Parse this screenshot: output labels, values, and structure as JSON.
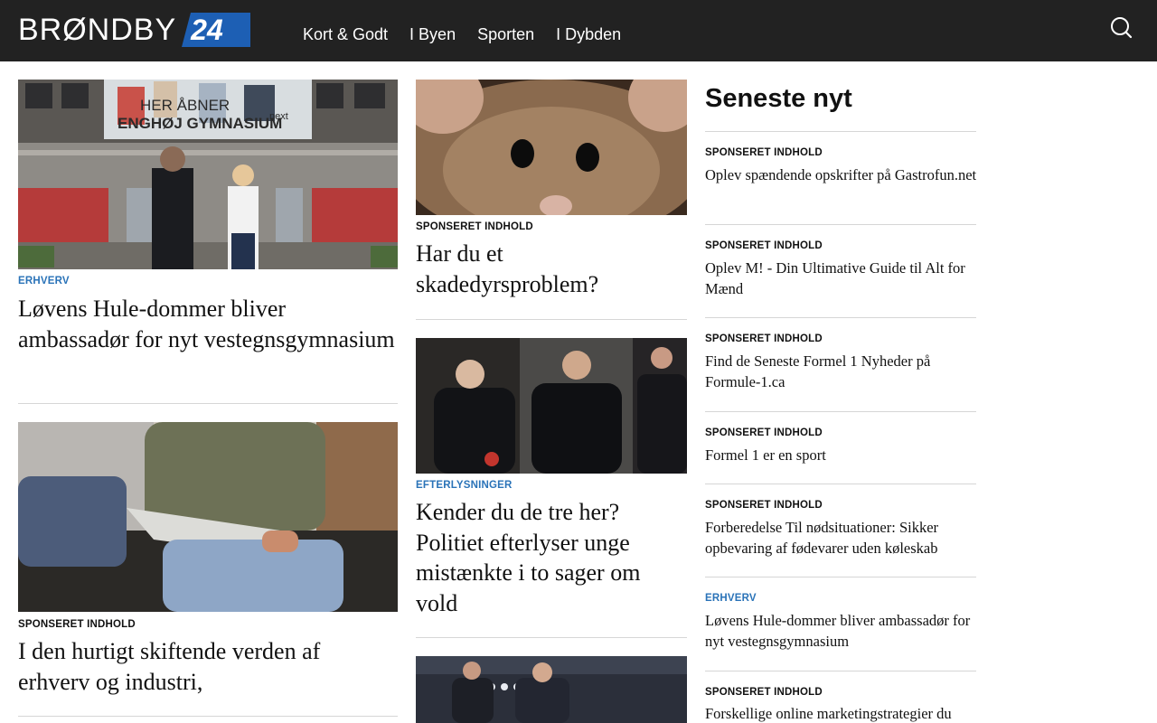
{
  "header": {
    "logo_text": "BRØNDBY",
    "logo_badge": "24",
    "nav": [
      "Kort & Godt",
      "I Byen",
      "Sporten",
      "I Dybden"
    ]
  },
  "colors": {
    "header_bg": "#222222",
    "category_blue": "#2a73b8",
    "logo_badge_blue": "#1d5fb4",
    "divider": "#d6d6d6"
  },
  "icons": {
    "search": "search-icon"
  },
  "left_column": [
    {
      "category": "ERHVERV",
      "category_style": "blue",
      "headline": "Løvens Hule-dommer bliver ambassadør for nyt vestegnsgymnasium",
      "image": "Man and woman in front of building with banner",
      "banner_line1": "HER ÅBNER",
      "banner_line2": "ENGHØJ GYMNASIUM",
      "banner_logo": "next"
    },
    {
      "category": "SPONSERET INDHOLD",
      "category_style": "black",
      "headline": "I den hurtigt skiftende verden af erhverv og industri,",
      "image": "Man in shorts reading a newspaper on a sofa"
    }
  ],
  "middle_column": [
    {
      "category": "SPONSERET INDHOLD",
      "category_style": "black",
      "headline": "Har du et skadedyrsproblem?",
      "image": "Close-up of a mouse"
    },
    {
      "category": "EFTERLYSNINGER",
      "category_style": "blue",
      "headline": "Kender du de tre her? Politiet efterlyser unge mistænkte i to sager om vold",
      "image": "Three young men in dark jackets"
    },
    {
      "image": "Police officers at night"
    }
  ],
  "sidebar": {
    "title": "Seneste nyt",
    "items": [
      {
        "category": "SPONSERET INDHOLD",
        "style": "black",
        "title": "Oplev spændende opskrifter på Gastrofun.net"
      },
      {
        "category": "SPONSERET INDHOLD",
        "style": "black",
        "title": "Oplev M! - Din Ultimative Guide til Alt for Mænd"
      },
      {
        "category": "SPONSERET INDHOLD",
        "style": "black",
        "title": "Find de Seneste Formel 1 Nyheder på Formule-1.ca"
      },
      {
        "category": "SPONSERET INDHOLD",
        "style": "black",
        "title": "Formel 1 er en sport"
      },
      {
        "category": "SPONSERET INDHOLD",
        "style": "black",
        "title": "Forberedelse Til nødsituationer: Sikker opbevaring af fødevarer uden køleskab"
      },
      {
        "category": "ERHVERV",
        "style": "blue",
        "title": "Løvens Hule-dommer bliver ambassadør for nyt vestegnsgymnasium"
      },
      {
        "category": "SPONSERET INDHOLD",
        "style": "black",
        "title": "Forskellige online marketingstrategier du"
      }
    ]
  }
}
